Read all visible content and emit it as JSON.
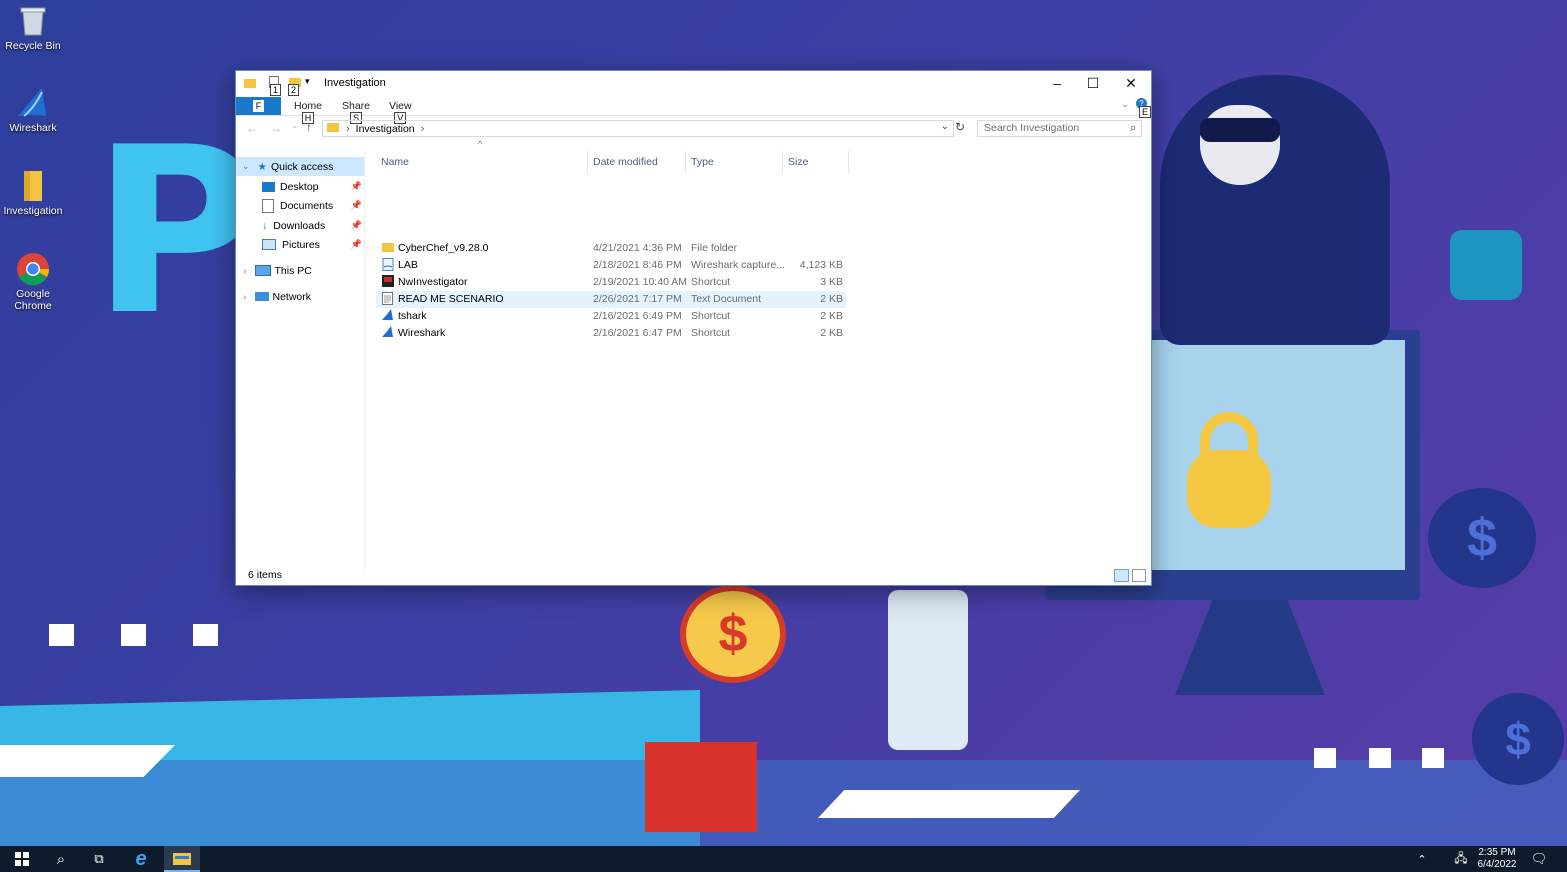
{
  "desktop": {
    "icons": [
      {
        "label": "Recycle Bin",
        "icon": "recycle-bin-icon"
      },
      {
        "label": "Wireshark",
        "icon": "wireshark-icon"
      },
      {
        "label": "Investigation",
        "icon": "folder-icon"
      },
      {
        "label": "Google Chrome",
        "icon": "chrome-icon"
      }
    ]
  },
  "window": {
    "title": "Investigation",
    "quick_access_keytips": [
      "1",
      "2"
    ],
    "ribbon": {
      "file_label": "F",
      "tabs": [
        {
          "label": "Home",
          "keytip": "H"
        },
        {
          "label": "Share",
          "keytip": "S"
        },
        {
          "label": "View",
          "keytip": "V"
        }
      ],
      "help_keytip": "E"
    },
    "address": {
      "path": "Investigation",
      "search_placeholder": "Search Investigation"
    },
    "nav": {
      "quick_access": "Quick access",
      "pinned": [
        "Desktop",
        "Documents",
        "Downloads",
        "Pictures"
      ],
      "this_pc": "This PC",
      "network": "Network"
    },
    "columns": {
      "name": "Name",
      "date": "Date modified",
      "type": "Type",
      "size": "Size"
    },
    "files": [
      {
        "name": "CyberChef_v9.28.0",
        "date": "4/21/2021 4:36 PM",
        "type": "File folder",
        "size": "",
        "icon": "folder-icon"
      },
      {
        "name": "LAB",
        "date": "2/18/2021 8:46 PM",
        "type": "Wireshark capture...",
        "size": "4,123 KB",
        "icon": "pcap-file-icon"
      },
      {
        "name": "NwInvestigator",
        "date": "2/19/2021 10:40 AM",
        "type": "Shortcut",
        "size": "3 KB",
        "icon": "nwinvestigator-icon"
      },
      {
        "name": "READ ME SCENARIO",
        "date": "2/26/2021 7:17 PM",
        "type": "Text Document",
        "size": "2 KB",
        "icon": "text-file-icon"
      },
      {
        "name": "tshark",
        "date": "2/16/2021 6:49 PM",
        "type": "Shortcut",
        "size": "2 KB",
        "icon": "wireshark-icon"
      },
      {
        "name": "Wireshark",
        "date": "2/16/2021 6:47 PM",
        "type": "Shortcut",
        "size": "2 KB",
        "icon": "wireshark-icon"
      }
    ],
    "status": "6 items"
  },
  "taskbar": {
    "time": "2:35 PM",
    "date": "6/4/2022"
  },
  "colors": {
    "accent": "#1979ca",
    "selection": "#e5f3ff",
    "taskbar": "#0e1b2b"
  }
}
